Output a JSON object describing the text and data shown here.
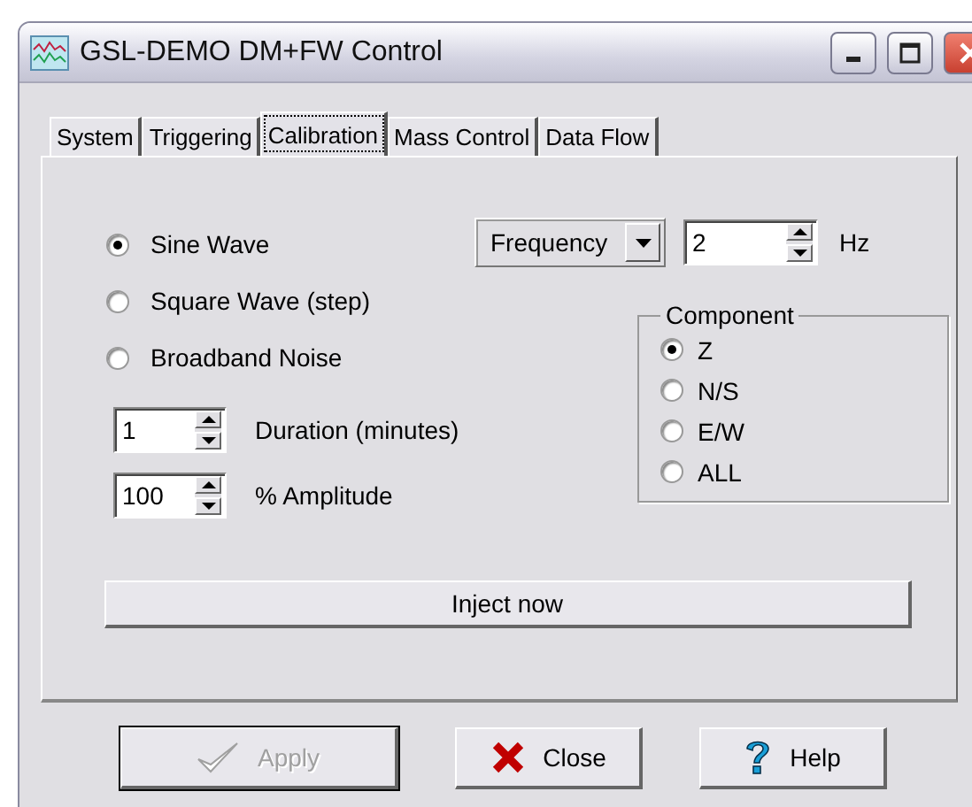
{
  "window": {
    "title": "GSL-DEMO DM+FW Control"
  },
  "tabs": [
    {
      "label": "System",
      "selected": false
    },
    {
      "label": "Triggering",
      "selected": false
    },
    {
      "label": "Calibration",
      "selected": true
    },
    {
      "label": "Mass Control",
      "selected": false
    },
    {
      "label": "Data Flow",
      "selected": false
    }
  ],
  "waveforms": [
    {
      "label": "Sine Wave",
      "selected": true
    },
    {
      "label": "Square Wave (step)",
      "selected": false
    },
    {
      "label": "Broadband Noise",
      "selected": false
    }
  ],
  "frequency_mode": {
    "value": "Frequency"
  },
  "frequency": {
    "value": "2",
    "unit": "Hz"
  },
  "duration": {
    "value": "1",
    "label": "Duration (minutes)"
  },
  "amplitude": {
    "value": "100",
    "label": "% Amplitude"
  },
  "component": {
    "title": "Component",
    "options": [
      {
        "label": "Z",
        "selected": true
      },
      {
        "label": "N/S",
        "selected": false
      },
      {
        "label": "E/W",
        "selected": false
      },
      {
        "label": "ALL",
        "selected": false
      }
    ]
  },
  "inject_button": "Inject now",
  "buttons": [
    {
      "label": "Apply",
      "kind": "apply",
      "disabled": true,
      "default": true
    },
    {
      "label": "Close",
      "kind": "close",
      "disabled": false,
      "default": false
    },
    {
      "label": "Help",
      "kind": "help",
      "disabled": false,
      "default": false
    }
  ]
}
